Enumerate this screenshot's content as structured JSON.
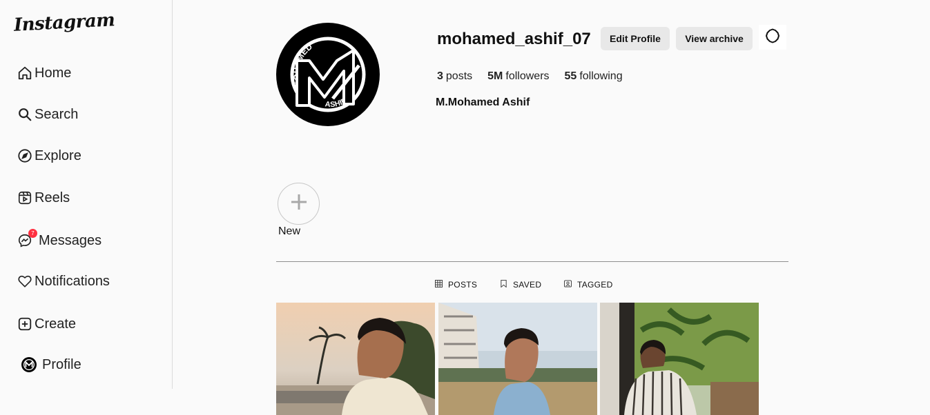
{
  "app": {
    "logo_text": "Instagram"
  },
  "sidebar": {
    "items": [
      {
        "label": "Home",
        "icon": "home-icon"
      },
      {
        "label": "Search",
        "icon": "search-icon"
      },
      {
        "label": "Explore",
        "icon": "compass-icon"
      },
      {
        "label": "Reels",
        "icon": "reels-icon"
      },
      {
        "label": "Messages",
        "icon": "messenger-icon",
        "badge": "7"
      },
      {
        "label": "Notifications",
        "icon": "heart-icon"
      },
      {
        "label": "Create",
        "icon": "plus-square-icon"
      },
      {
        "label": "Profile",
        "icon": "avatar-icon"
      }
    ]
  },
  "profile": {
    "username": "mohamed_ashif_07",
    "edit_label": "Edit Profile",
    "archive_label": "View archive",
    "stats": {
      "posts_count": "3",
      "posts_label": "posts",
      "followers_count": "5M",
      "followers_label": "followers",
      "following_count": "55",
      "following_label": "following"
    },
    "full_name": "M.Mohamed Ashif",
    "avatar_logo_top": "MOHAMED",
    "avatar_logo_bottom": "ASHIF"
  },
  "highlights": {
    "new_label": "New"
  },
  "tabs": [
    {
      "label": "POSTS",
      "icon": "grid-icon"
    },
    {
      "label": "SAVED",
      "icon": "bookmark-icon"
    },
    {
      "label": "TAGGED",
      "icon": "tagged-icon"
    }
  ],
  "colors": {
    "badge": "#ff3040",
    "button_bg": "#e8e8e8",
    "page_bg": "#fafafa"
  }
}
